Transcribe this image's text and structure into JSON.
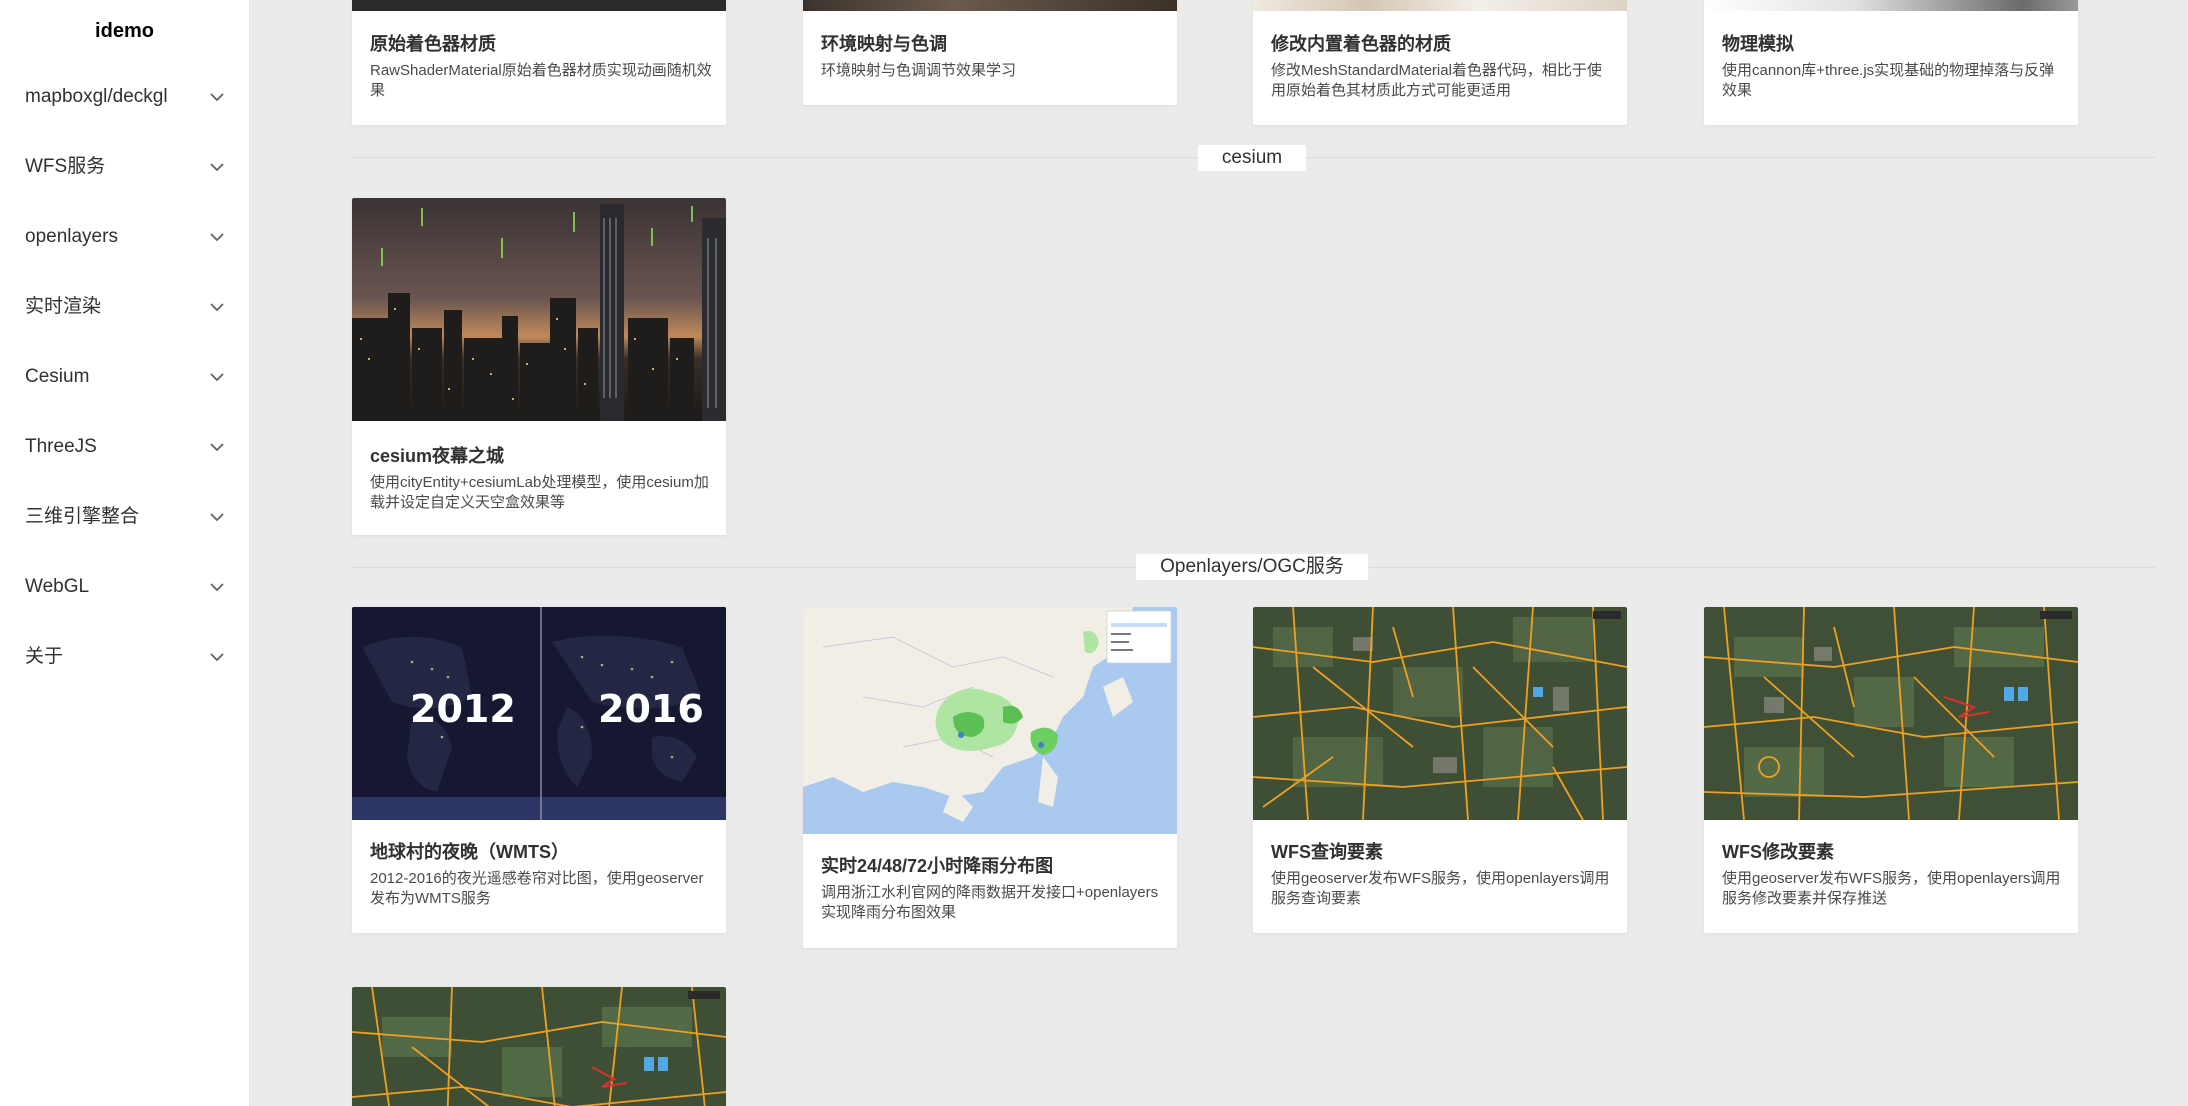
{
  "app": {
    "logo": "idemo"
  },
  "sidebar": {
    "items": [
      {
        "label": "mapboxgl/deckgl",
        "icon": "chevron-down-icon"
      },
      {
        "label": "WFS服务",
        "icon": "chevron-down-icon"
      },
      {
        "label": "openlayers",
        "icon": "chevron-down-icon"
      },
      {
        "label": "实时渲染",
        "icon": "chevron-down-icon"
      },
      {
        "label": "Cesium",
        "icon": "chevron-down-icon"
      },
      {
        "label": "ThreeJS",
        "icon": "chevron-down-icon"
      },
      {
        "label": "三维引擎整合",
        "icon": "chevron-down-icon"
      },
      {
        "label": "WebGL",
        "icon": "chevron-down-icon"
      },
      {
        "label": "关于",
        "icon": "chevron-down-icon"
      }
    ]
  },
  "sections": {
    "webgl": {
      "cards": [
        {
          "title": "原始着色器材质",
          "desc": "RawShaderMaterial原始着色器材质实现动画随机效果"
        },
        {
          "title": "环境映射与色调",
          "desc": "环境映射与色调调节效果学习"
        },
        {
          "title": "修改内置着色器的材质",
          "desc": "修改MeshStandardMaterial着色器代码，相比于使用原始着色其材质此方式可能更适用"
        },
        {
          "title": "物理模拟",
          "desc": "使用cannon库+three.js实现基础的物理掉落与反弹效果"
        }
      ]
    },
    "cesium": {
      "heading": "cesium",
      "cards": [
        {
          "title": "cesium夜幕之城",
          "desc": "使用cityEntity+cesiumLab处理模型，使用cesium加载并设定自定义天空盒效果等"
        }
      ]
    },
    "ogc": {
      "heading": "Openlayers/OGC服务",
      "cards": [
        {
          "title": "地球村的夜晚（WMTS）",
          "desc": "2012-2016的夜光遥感卷帘对比图，使用geoserver发布为WMTS服务",
          "thumb_left": "2012",
          "thumb_right": "2016"
        },
        {
          "title": "实时24/48/72小时降雨分布图",
          "desc": "调用浙江水利官网的降雨数据开发接口+openlayers实现降雨分布图效果"
        },
        {
          "title": "WFS查询要素",
          "desc": "使用geoserver发布WFS服务，使用openlayers调用服务查询要素"
        },
        {
          "title": "WFS修改要素",
          "desc": "使用geoserver发布WFS服务，使用openlayers调用服务修改要素并保存推送"
        }
      ]
    }
  },
  "colors": {
    "background": "#ebebeb",
    "card": "#ffffff",
    "divider": "#d6dbe6",
    "wfs_lines": "#f0a020"
  }
}
